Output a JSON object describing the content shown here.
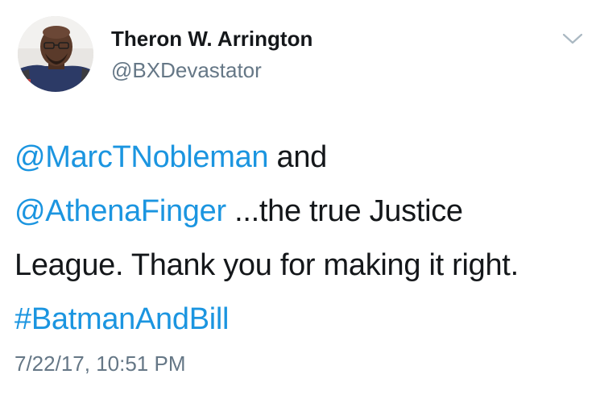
{
  "author": {
    "display_name": "Theron W. Arrington",
    "handle": "@BXDevastator",
    "avatar_icon": "user-avatar-photo"
  },
  "menu_icon": "chevron-down-icon",
  "tweet": {
    "line1": {
      "mention": "@MarcTNobleman",
      "text": " and"
    },
    "line2": {
      "mention": "@AthenaFinger",
      "text": " ...the true Justice"
    },
    "line3": {
      "text": "League. Thank you for making it right."
    },
    "line4": {
      "hashtag": "#BatmanAndBill"
    }
  },
  "timestamp": "7/22/17, 10:51 PM",
  "colors": {
    "link": "#1b95e0",
    "name": "#14171a",
    "secondary": "#657786"
  }
}
